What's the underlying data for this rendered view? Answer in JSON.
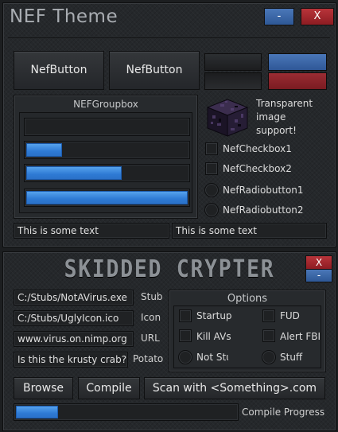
{
  "window1": {
    "title": "NEF Theme",
    "minimize_label": "-",
    "close_label": "X",
    "buttons": [
      "NefButton",
      "NefButton"
    ],
    "swatch_colors": {
      "dark1": "#2a2c2f",
      "dark2": "#1a1b1d",
      "blue": "#3a63a4",
      "red": "#8e2a30"
    },
    "groupbox": {
      "title": "NEFGroupbox",
      "progress": [
        0,
        0.22,
        0.59,
        1.0
      ]
    },
    "transparent_text": [
      "Transparent",
      "image",
      "support!"
    ],
    "checkboxes": [
      "NefCheckbox1",
      "NefCheckbox2"
    ],
    "radios": [
      "NefRadiobutton1",
      "NefRadiobutton2"
    ],
    "textboxes": [
      "This is some text",
      "This is some text"
    ]
  },
  "window2": {
    "title": "SKIDDED CRYPTER",
    "close_label": "X",
    "minimize_label": "-",
    "fields": [
      {
        "value": "C:/Stubs/NotAVirus.exe",
        "label": "Stub"
      },
      {
        "value": "C:/Stubs/UglyIcon.ico",
        "label": "Icon"
      },
      {
        "value": "www.virus.on.nimp.org",
        "label": "URL"
      },
      {
        "value": "Is this the krusty crab?",
        "label": "Potato"
      }
    ],
    "options": {
      "title": "Options",
      "checkboxes": [
        "Startup",
        "FUD",
        "Kill AVs",
        "Alert FBI"
      ],
      "radios": [
        "Not Stuff",
        "Stuff"
      ]
    },
    "buttons": {
      "browse": "Browse",
      "compile": "Compile",
      "scan": "Scan with <Something>.com"
    },
    "progress_label": "Compile Progress",
    "progress_value": 0.19,
    "accent": "#2e7ad4"
  }
}
